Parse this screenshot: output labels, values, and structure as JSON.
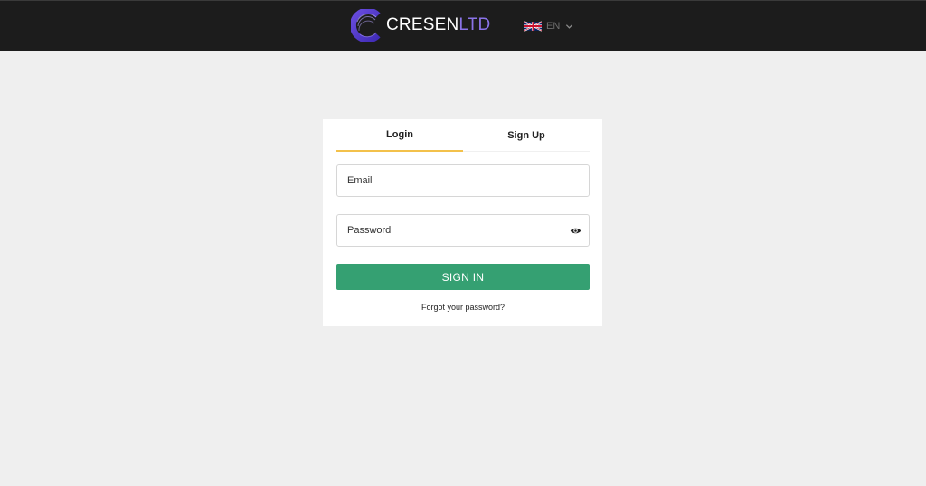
{
  "header": {
    "logo": {
      "text_primary": "CRESEN",
      "text_accent": "LTD"
    },
    "language": {
      "code": "EN",
      "flag_icon": "uk-flag-icon",
      "chevron_icon": "chevron-down-icon"
    }
  },
  "auth": {
    "tabs": [
      {
        "label": "Login",
        "active": true
      },
      {
        "label": "Sign Up",
        "active": false
      }
    ],
    "email": {
      "placeholder": "Email",
      "value": ""
    },
    "password": {
      "placeholder": "Password",
      "value": "",
      "toggle_icon": "eye-icon"
    },
    "submit_label": "SIGN IN",
    "forgot_label": "Forgot your password?"
  },
  "colors": {
    "header_bg": "#1c1c1c",
    "page_bg": "#efefef",
    "accent_purple": "#8a73e8",
    "tab_underline": "#f3c14b",
    "button_green": "#35a072"
  }
}
